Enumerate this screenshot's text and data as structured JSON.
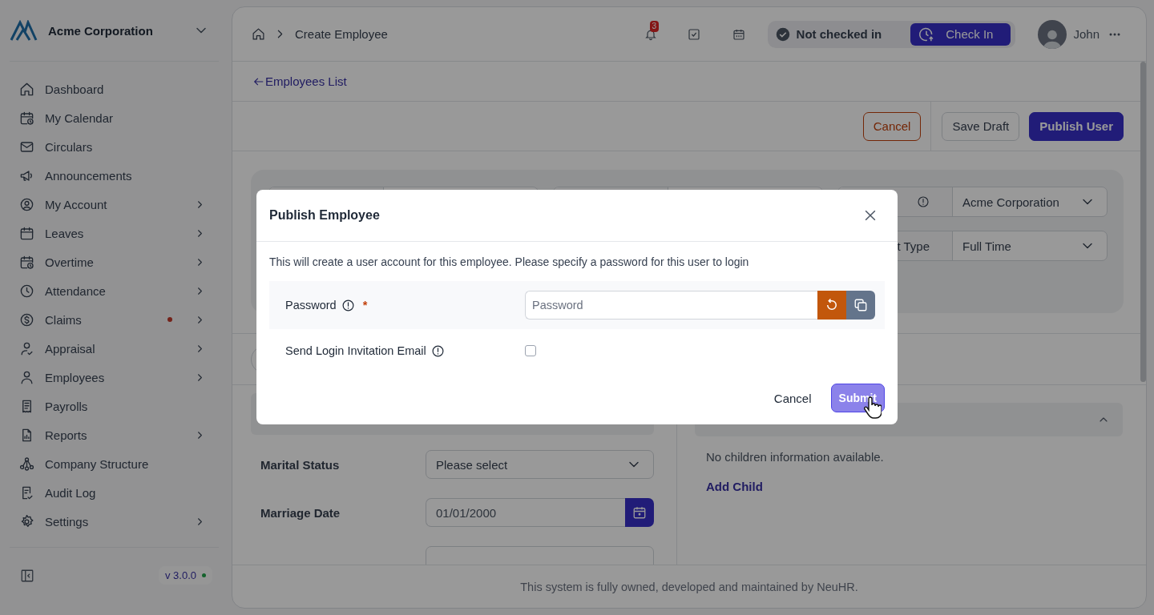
{
  "sidebar": {
    "company": "Acme Corporation",
    "items": [
      {
        "label": "Dashboard",
        "has_submenu": false,
        "alert": false
      },
      {
        "label": "My Calendar",
        "has_submenu": false,
        "alert": false
      },
      {
        "label": "Circulars",
        "has_submenu": false,
        "alert": false
      },
      {
        "label": "Announcements",
        "has_submenu": false,
        "alert": false
      },
      {
        "label": "My Account",
        "has_submenu": true,
        "alert": false
      },
      {
        "label": "Leaves",
        "has_submenu": true,
        "alert": false
      },
      {
        "label": "Overtime",
        "has_submenu": true,
        "alert": false
      },
      {
        "label": "Attendance",
        "has_submenu": true,
        "alert": false
      },
      {
        "label": "Claims",
        "has_submenu": true,
        "alert": true
      },
      {
        "label": "Appraisal",
        "has_submenu": true,
        "alert": false
      },
      {
        "label": "Employees",
        "has_submenu": true,
        "alert": false
      },
      {
        "label": "Payrolls",
        "has_submenu": false,
        "alert": false
      },
      {
        "label": "Reports",
        "has_submenu": true,
        "alert": false
      },
      {
        "label": "Company Structure",
        "has_submenu": false,
        "alert": false
      },
      {
        "label": "Audit Log",
        "has_submenu": false,
        "alert": false
      },
      {
        "label": "Settings",
        "has_submenu": true,
        "alert": false
      }
    ],
    "version": "v 3.0.0"
  },
  "topbar": {
    "breadcrumb": "Create Employee",
    "notification_count": "3",
    "status": "Not checked in",
    "check_in_button": "Check In",
    "user": "John"
  },
  "back_link": "Employees List",
  "actions": [
    {
      "label": "Cancel",
      "kind": "danger"
    },
    {
      "label": "Save Draft",
      "kind": "default"
    },
    {
      "label": "Publish User",
      "kind": "primary"
    }
  ],
  "form_card": {
    "fields": [
      {
        "value": "Acme Corporation"
      },
      {
        "label": "t Type",
        "value": "Full Time"
      }
    ]
  },
  "personal": {
    "fields": [
      {
        "label": "Marital Status",
        "kind": "select",
        "value": "Please select"
      },
      {
        "label": "Marriage Date",
        "kind": "date",
        "value": "01/01/2000"
      }
    ]
  },
  "children": {
    "expanded": true,
    "empty_text": "No children information available.",
    "add_link": "Add Child"
  },
  "footer": "This system is fully owned, developed and maintained by NeuHR.",
  "modal": {
    "title": "Publish Employee",
    "message": "This will create a user account for this employee. Please specify a password for this user to login",
    "password": {
      "label": "Password",
      "required_mark": "*",
      "placeholder": "Password"
    },
    "invitation": {
      "label": "Send Login Invitation Email",
      "checked": false
    },
    "buttons": [
      {
        "label": "Cancel",
        "kind": "text"
      },
      {
        "label": "Submit",
        "kind": "primary"
      }
    ]
  }
}
